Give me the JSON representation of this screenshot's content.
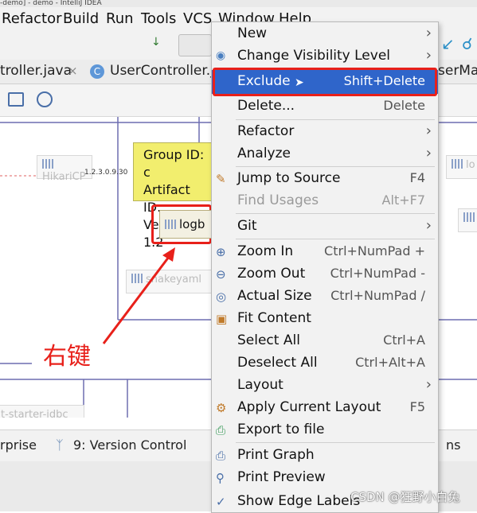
{
  "window_title": "-demo] - demo - IntelliJ IDEA",
  "menubar": [
    "Refactor",
    "Build",
    "Run",
    "Tools",
    "VCS",
    "Window",
    "Help"
  ],
  "tabs": [
    "troller.java",
    "UserController.ja",
    "serMa"
  ],
  "group_tooltip": {
    "l1": "Group ID: c",
    "l2": "Artifact ID:",
    "l3": "Version: 1.2"
  },
  "nodes": {
    "hikari": "HikariCP",
    "logback": "logb",
    "snakeyaml": "snakeyaml",
    "starter": "t-starter-jdbc",
    "right1": "lo"
  },
  "edge_label": "1.2.3.0.9.30",
  "annotation": "右键",
  "bottom": {
    "left": "rprise",
    "version_control": "9: Version Control",
    "right": "ns"
  },
  "watermark": "CSDN @狂野小白兔",
  "context_menu": {
    "items": [
      {
        "label": "New",
        "shortcut": "",
        "submenu": true
      },
      {
        "label": "Change Visibility Level",
        "shortcut": "",
        "submenu": true
      },
      {
        "label": "Exclude",
        "shortcut": "Shift+Delete",
        "submenu": false
      },
      {
        "label": "Delete...",
        "shortcut": "Delete",
        "submenu": false
      },
      {
        "label": "Refactor",
        "shortcut": "",
        "submenu": true
      },
      {
        "label": "Analyze",
        "shortcut": "",
        "submenu": true
      },
      {
        "label": "Jump to Source",
        "shortcut": "F4",
        "submenu": false
      },
      {
        "label": "Find Usages",
        "shortcut": "Alt+F7",
        "submenu": false
      },
      {
        "label": "Git",
        "shortcut": "",
        "submenu": true
      },
      {
        "label": "Zoom In",
        "shortcut": "Ctrl+NumPad +",
        "submenu": false
      },
      {
        "label": "Zoom Out",
        "shortcut": "Ctrl+NumPad -",
        "submenu": false
      },
      {
        "label": "Actual Size",
        "shortcut": "Ctrl+NumPad /",
        "submenu": false
      },
      {
        "label": "Fit Content",
        "shortcut": "",
        "submenu": false
      },
      {
        "label": "Select All",
        "shortcut": "Ctrl+A",
        "submenu": false
      },
      {
        "label": "Deselect All",
        "shortcut": "Ctrl+Alt+A",
        "submenu": false
      },
      {
        "label": "Layout",
        "shortcut": "",
        "submenu": true
      },
      {
        "label": "Apply Current Layout",
        "shortcut": "F5",
        "submenu": false
      },
      {
        "label": "Export to file",
        "shortcut": "",
        "submenu": false
      },
      {
        "label": "Print Graph",
        "shortcut": "",
        "submenu": false
      },
      {
        "label": "Print Preview",
        "shortcut": "",
        "submenu": false
      },
      {
        "label": "Show Edge Labels",
        "shortcut": "",
        "submenu": false
      }
    ]
  },
  "colors": {
    "highlight": "#2f65ca",
    "annotation_red": "#e8201a",
    "tooltip_yellow": "#f2ee6e"
  }
}
